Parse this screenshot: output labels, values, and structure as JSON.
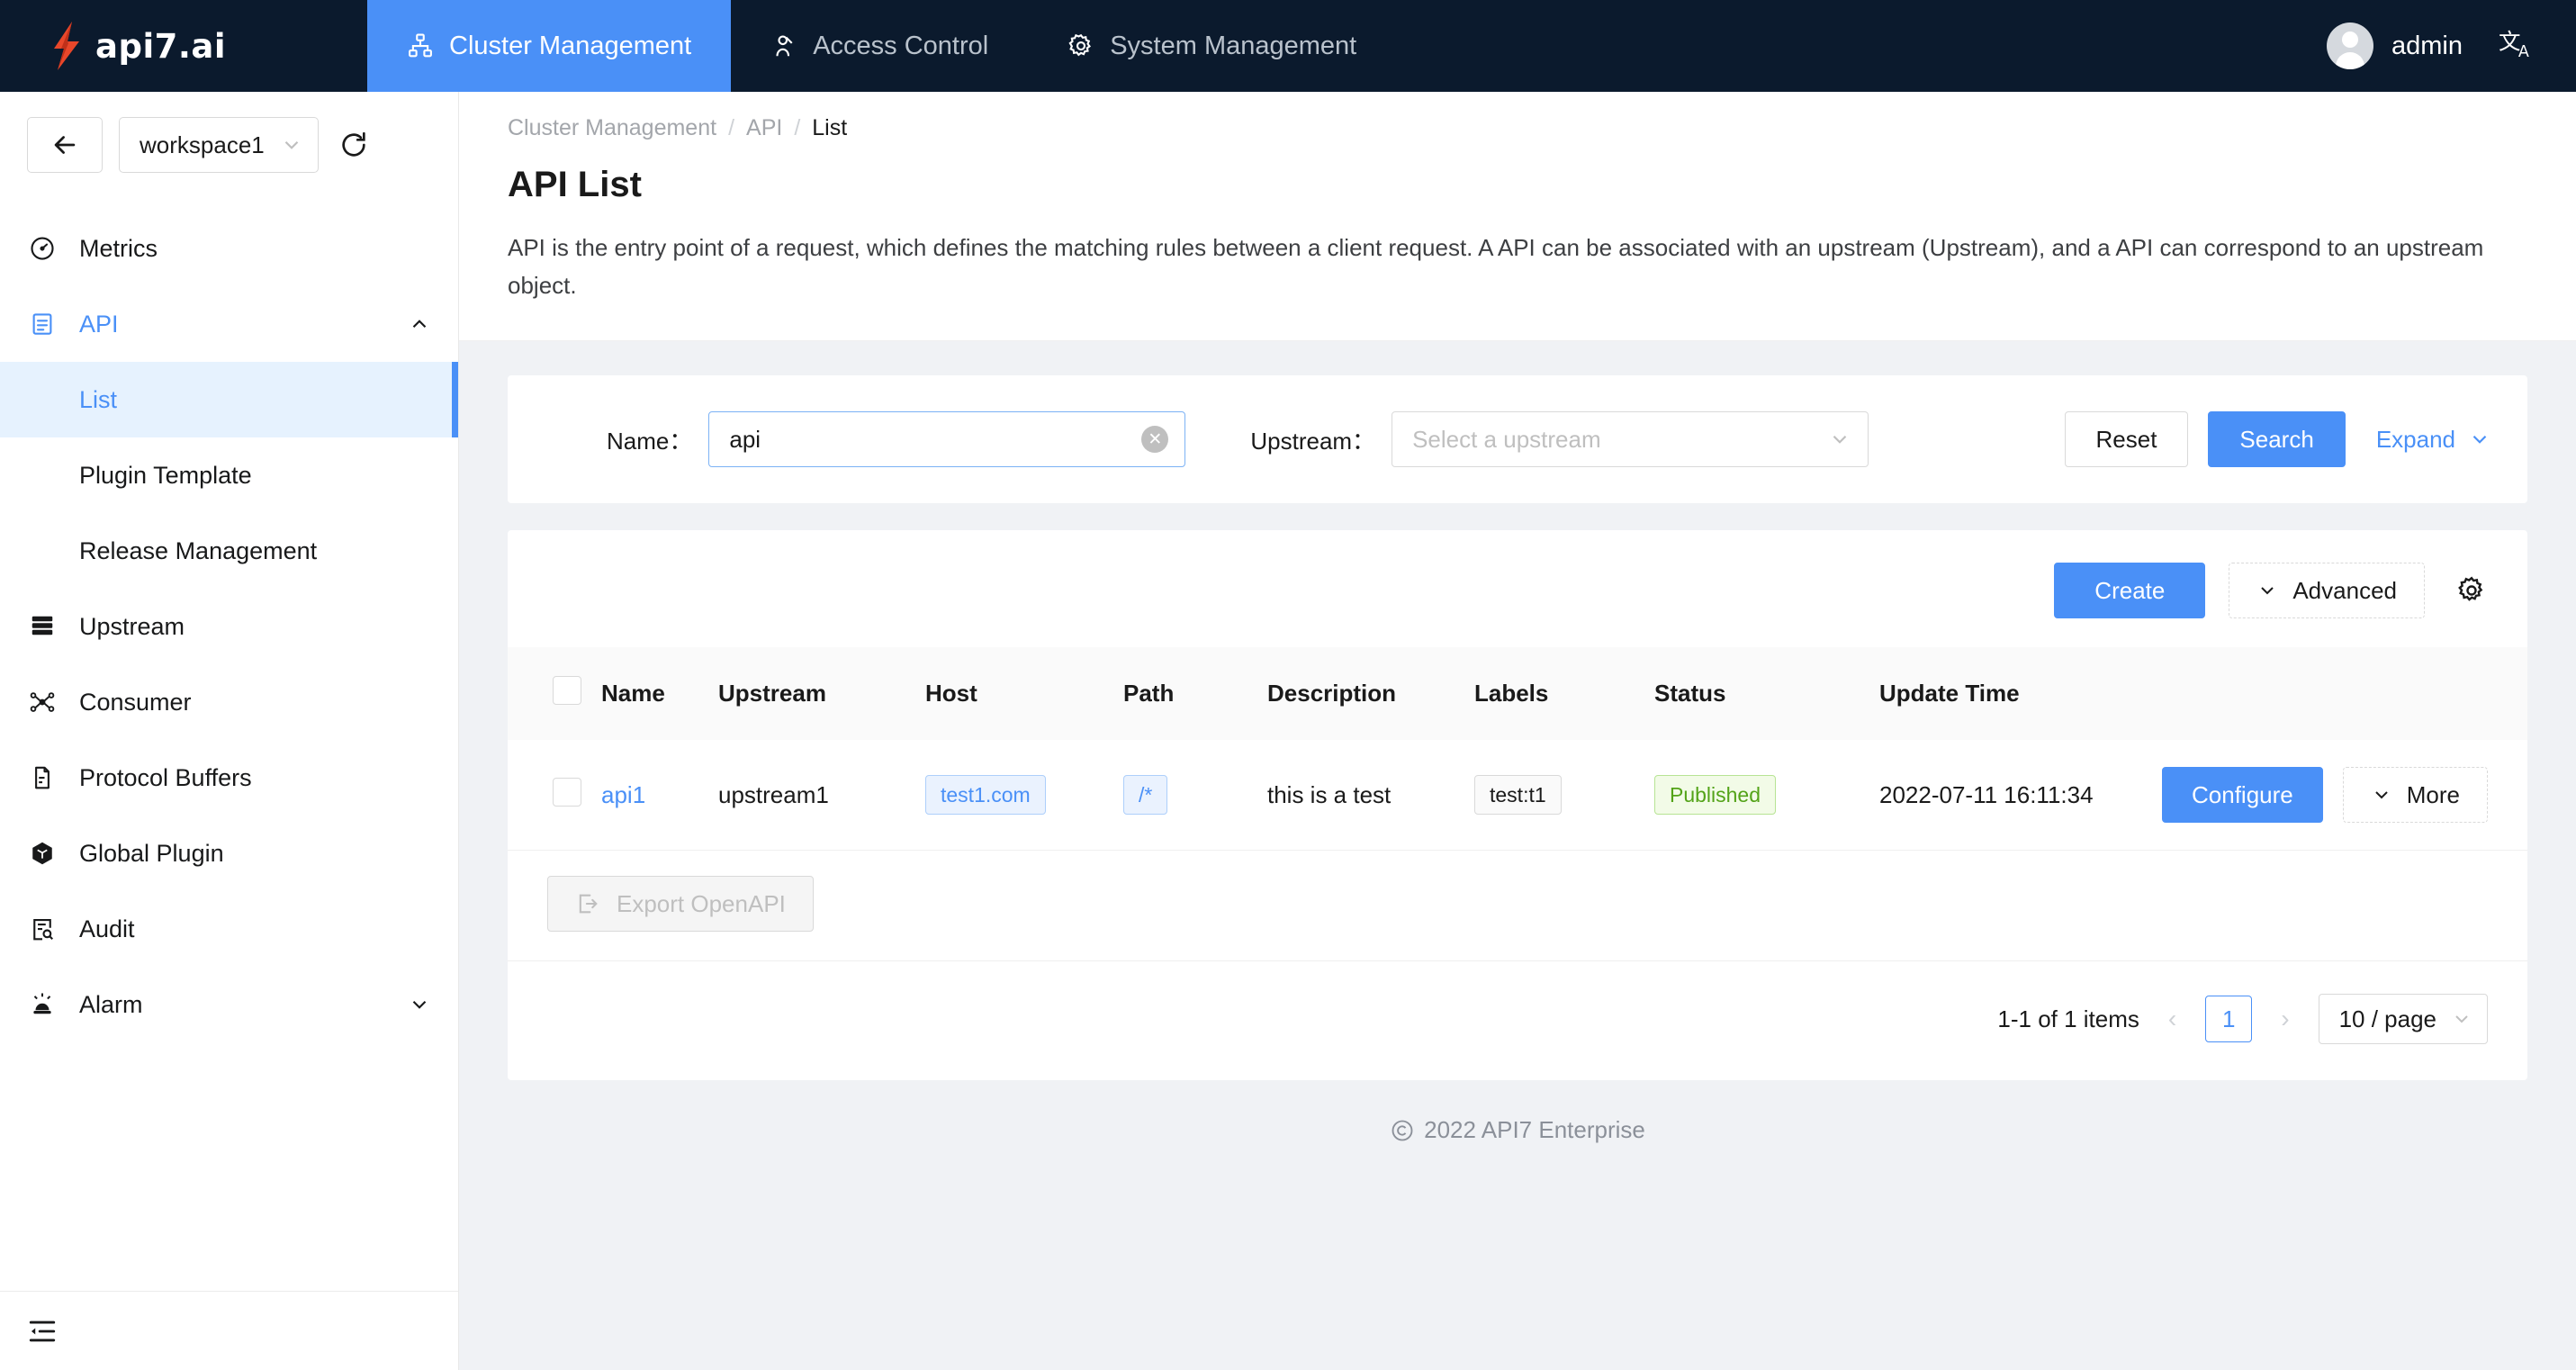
{
  "topnav": {
    "brand": "api7.ai",
    "items": [
      {
        "label": "Cluster Management",
        "icon": "cluster-icon",
        "active": true
      },
      {
        "label": "Access Control",
        "icon": "user-access-icon",
        "active": false
      },
      {
        "label": "System Management",
        "icon": "gear-icon",
        "active": false
      }
    ],
    "username": "admin",
    "lang_icon": "translate-icon",
    "accent": "#4a90f7",
    "bg": "#0b1a2d"
  },
  "sidebar": {
    "back_icon": "arrow-left-icon",
    "workspace": "workspace1",
    "refresh_icon": "refresh-icon",
    "collapse_icon": "menu-fold-icon",
    "items": [
      {
        "label": "Metrics",
        "icon": "dashboard-icon",
        "type": "item"
      },
      {
        "label": "API",
        "icon": "api-doc-icon",
        "type": "parent",
        "expanded": true
      },
      {
        "label": "List",
        "type": "sub",
        "active": true
      },
      {
        "label": "Plugin Template",
        "type": "sub",
        "active": false
      },
      {
        "label": "Release Management",
        "type": "sub",
        "active": false
      },
      {
        "label": "Upstream",
        "icon": "server-icon",
        "type": "item"
      },
      {
        "label": "Consumer",
        "icon": "nodes-icon",
        "type": "item"
      },
      {
        "label": "Protocol Buffers",
        "icon": "file-icon",
        "type": "item"
      },
      {
        "label": "Global Plugin",
        "icon": "cube-icon",
        "type": "item"
      },
      {
        "label": "Audit",
        "icon": "audit-icon",
        "type": "item"
      },
      {
        "label": "Alarm",
        "icon": "alarm-icon",
        "type": "parent",
        "expanded": false
      }
    ]
  },
  "page": {
    "breadcrumb": [
      "Cluster Management",
      "API",
      "List"
    ],
    "title": "API List",
    "description": "API is the entry point of a request, which defines the matching rules between a client request. A API can be associated with an upstream (Upstream), and a API can correspond to an upstream object."
  },
  "filters": {
    "name_label": "Name：",
    "name_value": "api",
    "name_clear_icon": "clear-circle-icon",
    "upstream_label": "Upstream：",
    "upstream_placeholder": "Select a upstream",
    "upstream_value": "",
    "reset_label": "Reset",
    "search_label": "Search",
    "expand_label": "Expand"
  },
  "toolbar": {
    "create_label": "Create",
    "advanced_label": "Advanced",
    "settings_icon": "gear-icon"
  },
  "table": {
    "columns": [
      "Name",
      "Upstream",
      "Host",
      "Path",
      "Description",
      "Labels",
      "Status",
      "Update Time"
    ],
    "rows": [
      {
        "name": "api1",
        "upstream": "upstream1",
        "host": "test1.com",
        "path": "/*",
        "description": "this is a test",
        "labels": "test:t1",
        "status": "Published",
        "update_time": "2022-07-11 16:11:34",
        "configure_label": "Configure",
        "more_label": "More"
      }
    ]
  },
  "bulk": {
    "export_label": "Export OpenAPI",
    "export_icon": "export-icon"
  },
  "pagination": {
    "summary": "1-1 of 1 items",
    "prev_icon": "chevron-left-icon",
    "next_icon": "chevron-right-icon",
    "current_page": "1",
    "page_size": "10 / page"
  },
  "footer": {
    "copyright_icon": "copyright-icon",
    "text": "2022 API7 Enterprise"
  }
}
